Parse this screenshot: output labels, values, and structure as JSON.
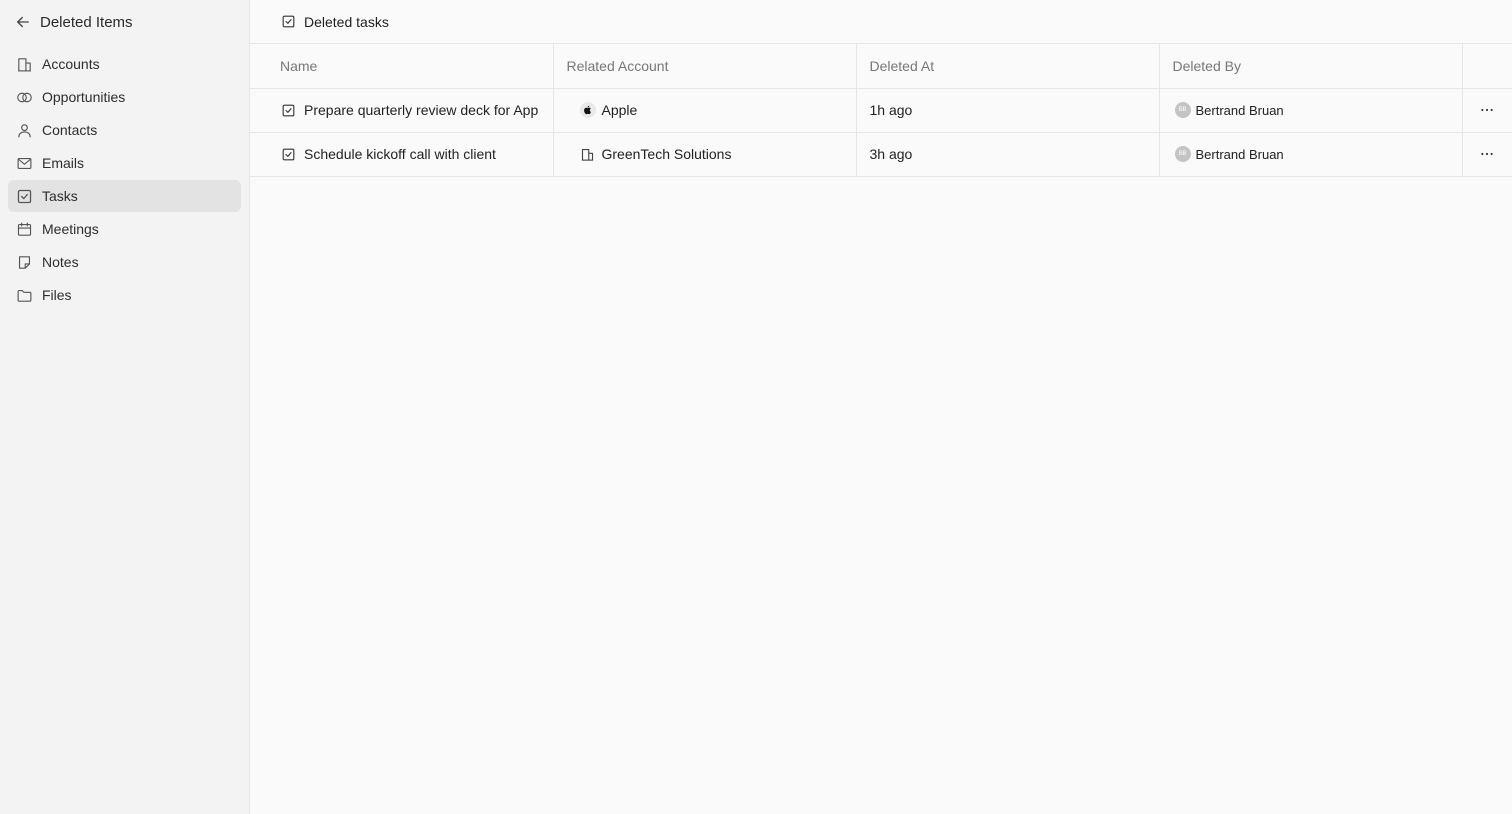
{
  "sidebar": {
    "title": "Deleted Items",
    "items": [
      {
        "label": "Accounts",
        "icon": "building-icon"
      },
      {
        "label": "Opportunities",
        "icon": "rings-icon"
      },
      {
        "label": "Contacts",
        "icon": "person-icon"
      },
      {
        "label": "Emails",
        "icon": "mail-icon"
      },
      {
        "label": "Tasks",
        "icon": "checkbox-icon",
        "active": true
      },
      {
        "label": "Meetings",
        "icon": "calendar-icon"
      },
      {
        "label": "Notes",
        "icon": "note-icon"
      },
      {
        "label": "Files",
        "icon": "folder-icon"
      }
    ]
  },
  "main": {
    "title": "Deleted tasks",
    "columns": [
      "Name",
      "Related Account",
      "Deleted At",
      "Deleted By"
    ],
    "rows": [
      {
        "name": "Prepare quarterly review deck for Apple",
        "account": "Apple",
        "account_icon": "apple-logo-icon",
        "deleted_at": "1h ago",
        "deleted_by": "Bertrand Bruan",
        "initials": "BB"
      },
      {
        "name": "Schedule kickoff call with client",
        "account": "GreenTech Solutions",
        "account_icon": "building-icon",
        "deleted_at": "3h ago",
        "deleted_by": "Bertrand Bruan",
        "initials": "BB"
      }
    ]
  },
  "colors": {
    "sidebar_bg": "#f3f3f3",
    "active_item_bg": "#e3e3e3",
    "main_bg": "#fafafa",
    "border": "#e6e6e6",
    "header_text": "#777777",
    "avatar_bg": "#c4c4c4"
  }
}
